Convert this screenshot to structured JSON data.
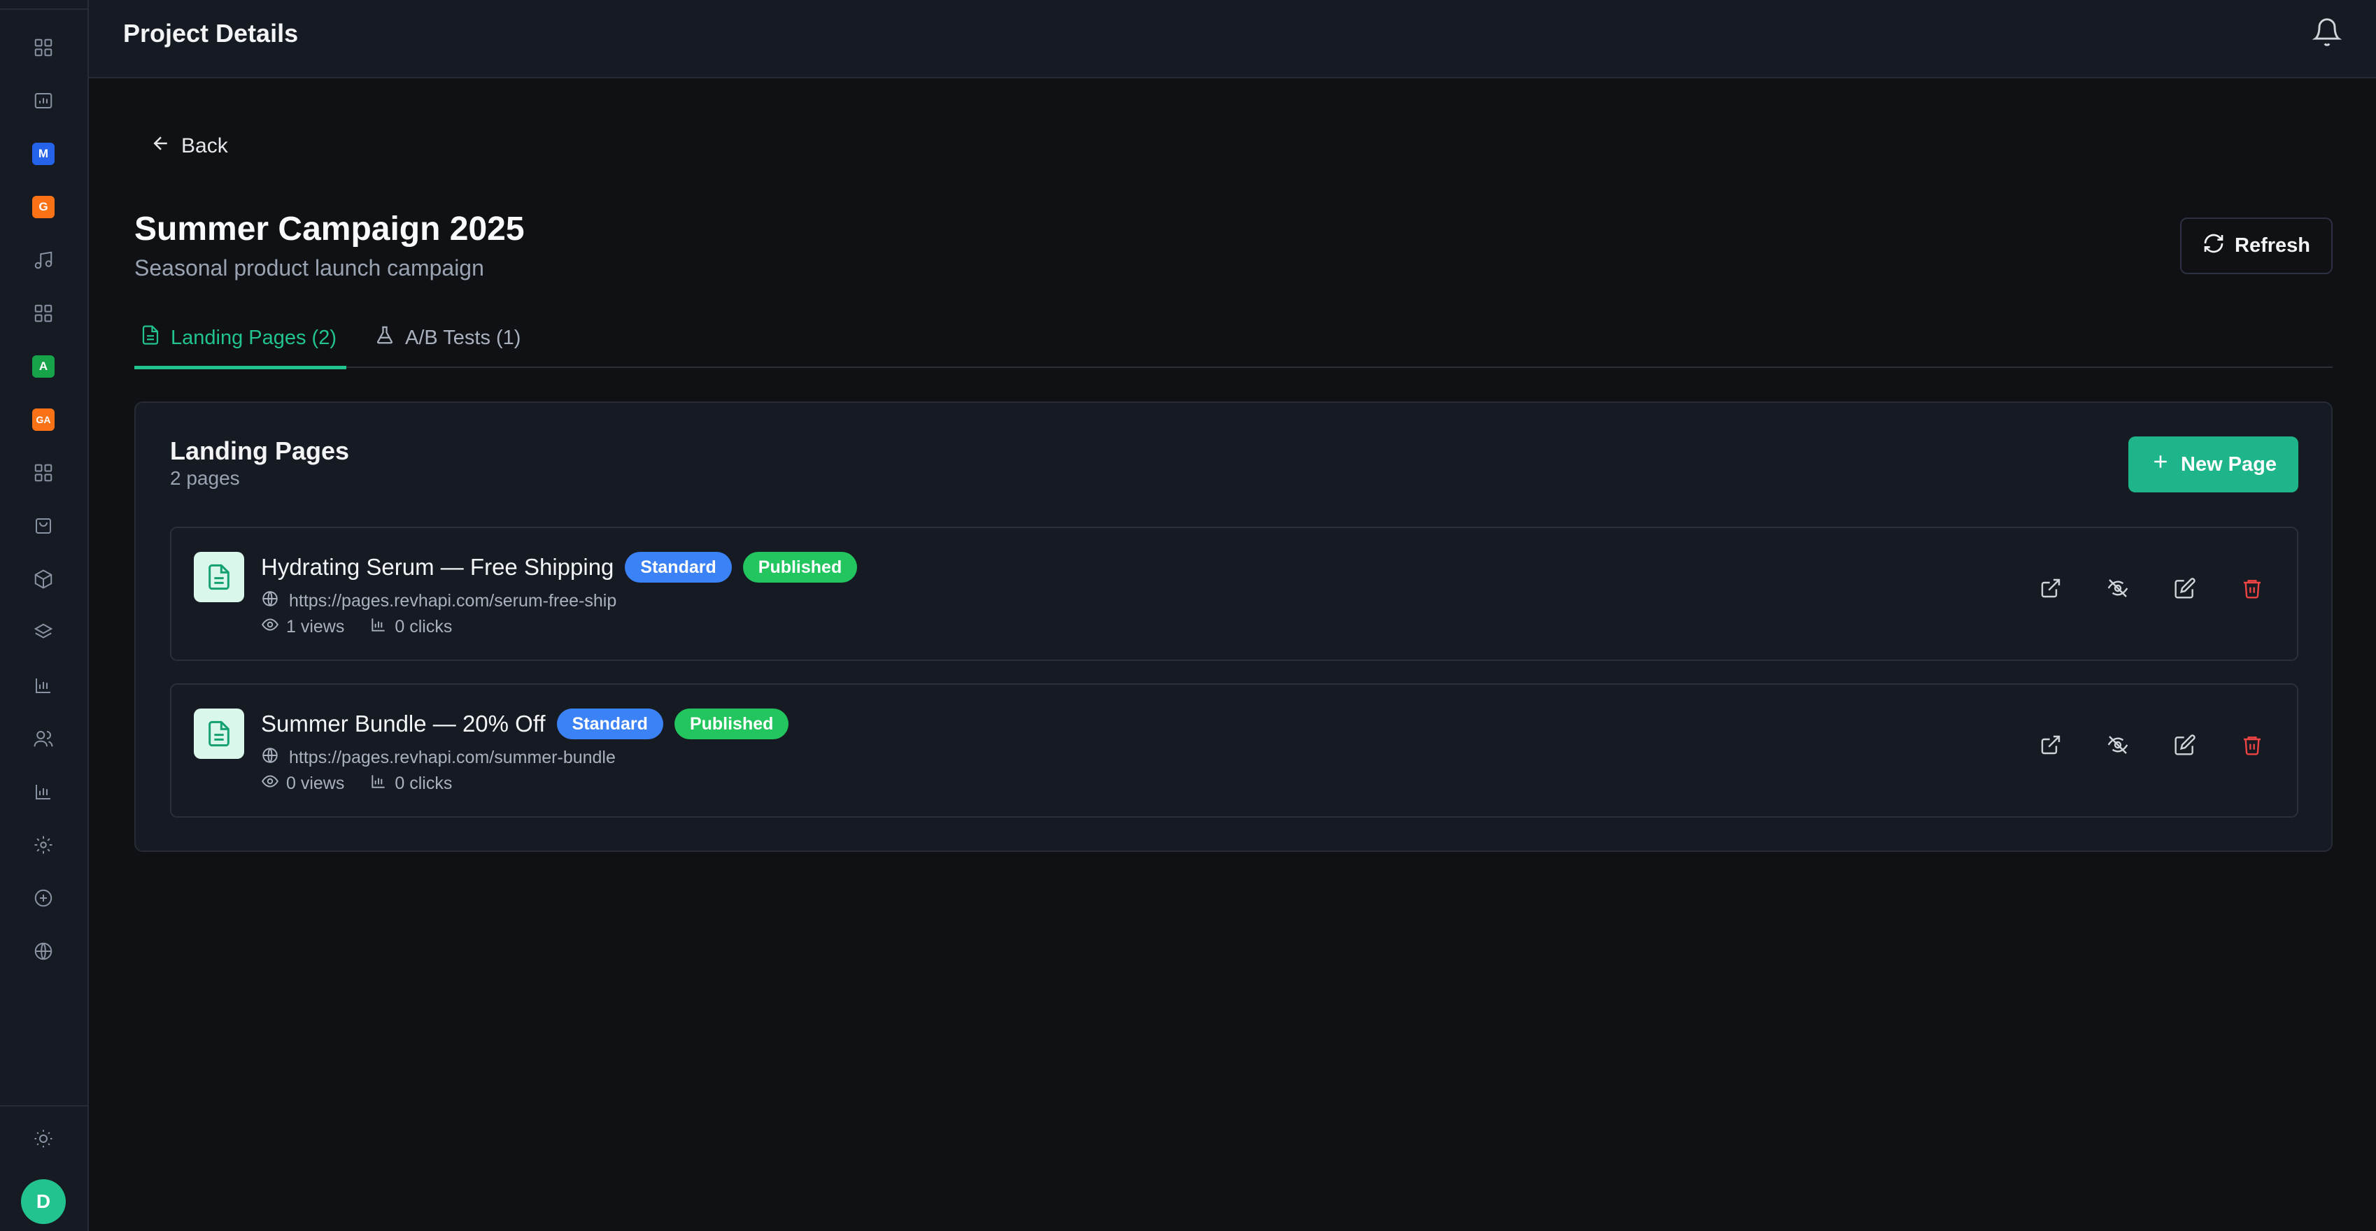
{
  "header": {
    "title": "Project Details"
  },
  "sidebar": {
    "icons": [
      "dashboard-icon",
      "folder-chart-icon",
      "m-badge-icon",
      "g-badge-icon",
      "music-icon",
      "dashboard-icon",
      "a-badge-icon",
      "ga-badge-icon",
      "dashboard-icon",
      "shopping-bag-icon",
      "box-icon",
      "layers-icon",
      "bar-chart-icon",
      "users-icon",
      "bar-chart-icon",
      "settings-icon",
      "plus-circle-icon",
      "globe-icon"
    ],
    "badges": {
      "m": "M",
      "g": "G",
      "a": "A",
      "ga": "GA"
    },
    "badge_colors": {
      "m": "#2563eb",
      "g": "#f97316",
      "a": "#16a34a",
      "ga": "#f97316"
    },
    "avatar_initial": "D"
  },
  "back": {
    "label": "Back"
  },
  "campaign": {
    "title": "Summer Campaign 2025",
    "subtitle": "Seasonal product launch campaign"
  },
  "refresh": {
    "label": "Refresh"
  },
  "tabs": [
    {
      "label": "Landing Pages (2)",
      "active": true
    },
    {
      "label": "A/B Tests (1)",
      "active": false
    }
  ],
  "panel": {
    "title": "Landing Pages",
    "subtitle": "2 pages",
    "new_button": "New Page"
  },
  "pages": [
    {
      "title": "Hydrating Serum — Free Shipping",
      "type_badge": "Standard",
      "status_badge": "Published",
      "url": "https://pages.revhapi.com/serum-free-ship",
      "views": "1 views",
      "clicks": "0 clicks"
    },
    {
      "title": "Summer Bundle — 20% Off",
      "type_badge": "Standard",
      "status_badge": "Published",
      "url": "https://pages.revhapi.com/summer-bundle",
      "views": "0 views",
      "clicks": "0 clicks"
    }
  ],
  "colors": {
    "accent": "#22c38e",
    "badge_blue": "#3b82f6",
    "badge_green": "#22c55e",
    "danger": "#ef4444"
  }
}
